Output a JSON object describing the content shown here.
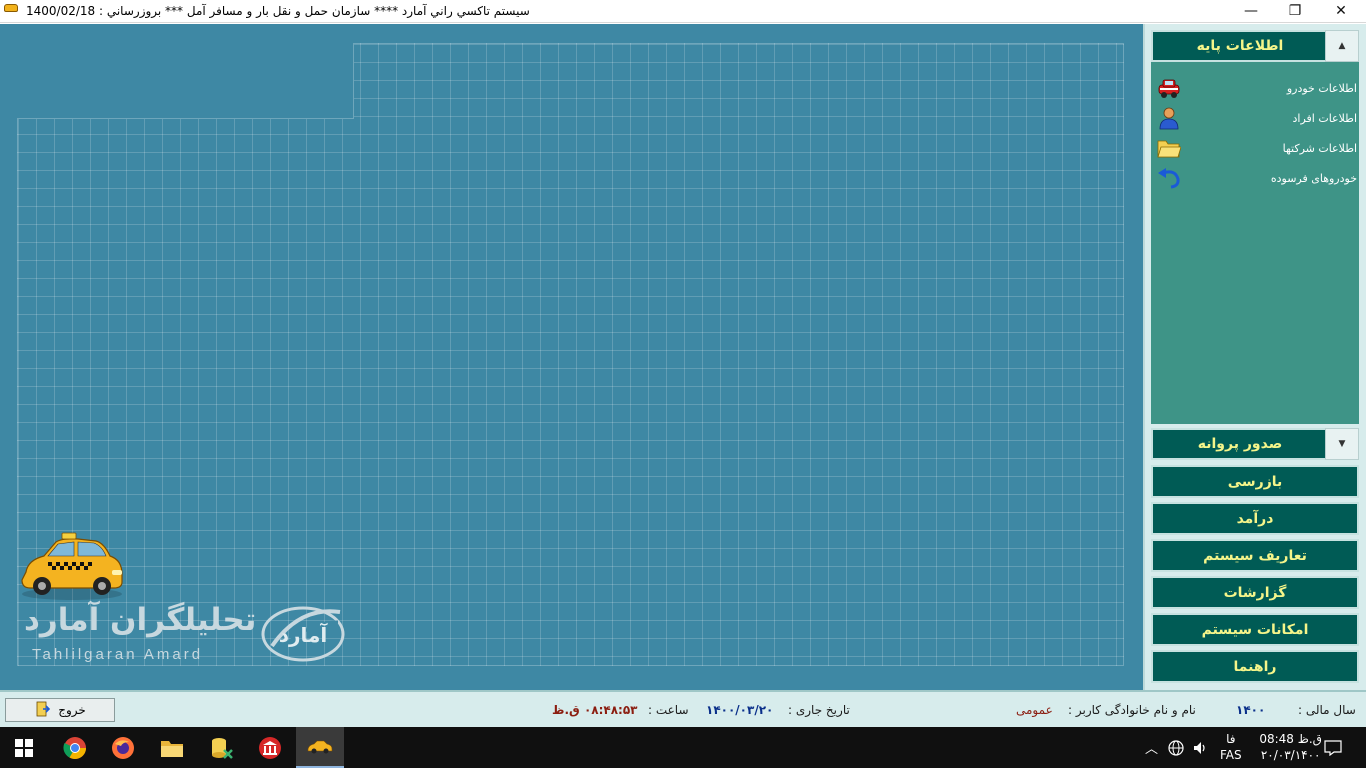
{
  "titlebar": {
    "title": "سيستم تاكسي راني آمارد ****  سازمان حمل و نقل بار و مسافر آمل  ***   بروزرساني : 1400/02/18",
    "minimize": "—",
    "maximize": "❐",
    "close": "✕"
  },
  "branding": {
    "company_fa": "تحلیلگران آمارد",
    "company_en": "Tahlilgaran Amard",
    "emblem_text": "آمارد"
  },
  "side_panel": {
    "group_base_info": {
      "label": "اطلاعات پایه",
      "chevron": "▲",
      "items": [
        {
          "label": "اطلاعات خودرو",
          "icon": "car-icon"
        },
        {
          "label": "اطلاعات افراد",
          "icon": "person-icon"
        },
        {
          "label": "اطلاعات شرکتها",
          "icon": "folder-icon"
        },
        {
          "label": "خودروهای فرسوده",
          "icon": "undo-arrow-icon"
        }
      ]
    },
    "group_license": {
      "label": "صدور پروانه",
      "chevron": "▼"
    },
    "buttons": [
      {
        "label": "بازرسی"
      },
      {
        "label": "درآمد"
      },
      {
        "label": "تعاریف سیستم"
      },
      {
        "label": "گزارشات"
      },
      {
        "label": "امکانات سیستم"
      },
      {
        "label": "راهنما"
      }
    ]
  },
  "statusbar": {
    "exit_label": "خروج",
    "fiscal_year_label": "سال مالی :",
    "fiscal_year_value": "۱۴۰۰",
    "user_label": "نام و نام خانوادگی کاربر :",
    "user_value": "عمومی",
    "date_label": "تاریخ جاری :",
    "date_value": "۱۴۰۰/۰۳/۲۰",
    "time_label": "ساعت :",
    "time_value": "۰۸:۴۸:۵۳ ق.ظ"
  },
  "taskbar": {
    "clock_time": "ق.ظ 08:48",
    "clock_date": "۲۰/۰۳/۱۴۰۰",
    "lang_top": "فا",
    "lang_bottom": "FAS"
  },
  "colors": {
    "workspace": "#3e88a4",
    "menu_bg": "#005b55",
    "menu_text": "#f5f58a",
    "panel_body": "#3e9487"
  }
}
